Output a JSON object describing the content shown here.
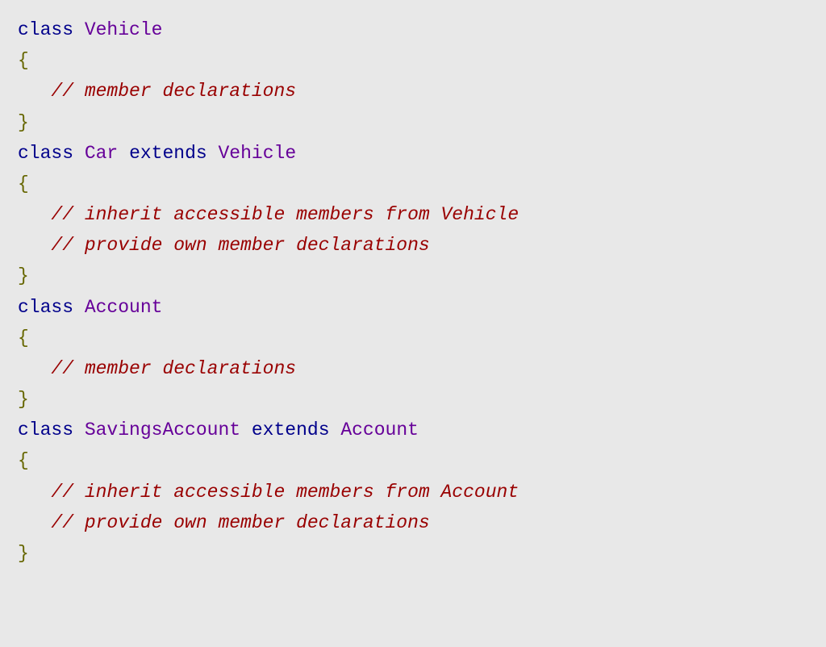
{
  "tokens": {
    "kw_class": "class",
    "kw_extends": "extends",
    "brace_open": "{",
    "brace_close": "}"
  },
  "classes": {
    "vehicle": {
      "name": "Vehicle",
      "body_comments": [
        "// member declarations"
      ]
    },
    "car": {
      "name": "Car",
      "extends": "Vehicle",
      "body_comments": [
        "// inherit accessible members from Vehicle",
        "// provide own member declarations"
      ]
    },
    "account": {
      "name": "Account",
      "body_comments": [
        "// member declarations"
      ]
    },
    "savings_account": {
      "name": "SavingsAccount",
      "extends": "Account",
      "body_comments": [
        "// inherit accessible members from Account",
        "// provide own member declarations"
      ]
    }
  }
}
